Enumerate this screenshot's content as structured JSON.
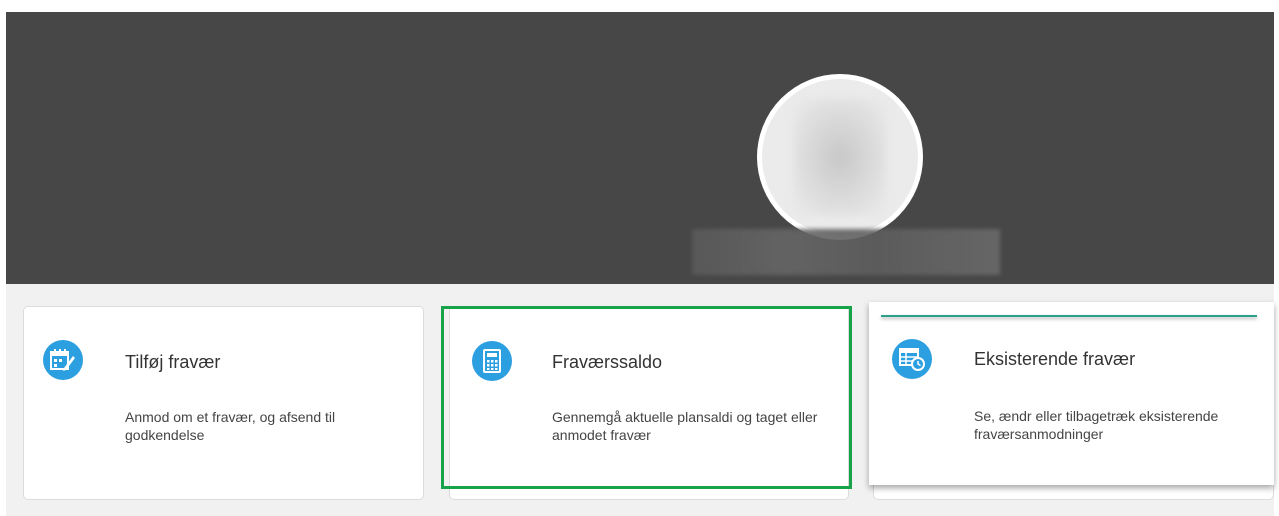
{
  "cards": [
    {
      "title": "Tilføj fravær",
      "description": "Anmod om et fravær, og afsend til godkendelse",
      "icon": "calendar-edit-icon"
    },
    {
      "title": "Fraværssaldo",
      "description": "Gennemgå aktuelle plansaldi og taget eller anmodet fravær",
      "icon": "calculator-icon"
    },
    {
      "title": "Eksisterende fravær",
      "description": "Se, ændr eller tilbagetræk eksisterende fraværsanmodninger",
      "icon": "table-clock-icon"
    }
  ],
  "colors": {
    "banner": "#474747",
    "icon_circle": "#2c9fe0",
    "highlight": "#17a34a",
    "accent": "#2aa08a"
  }
}
